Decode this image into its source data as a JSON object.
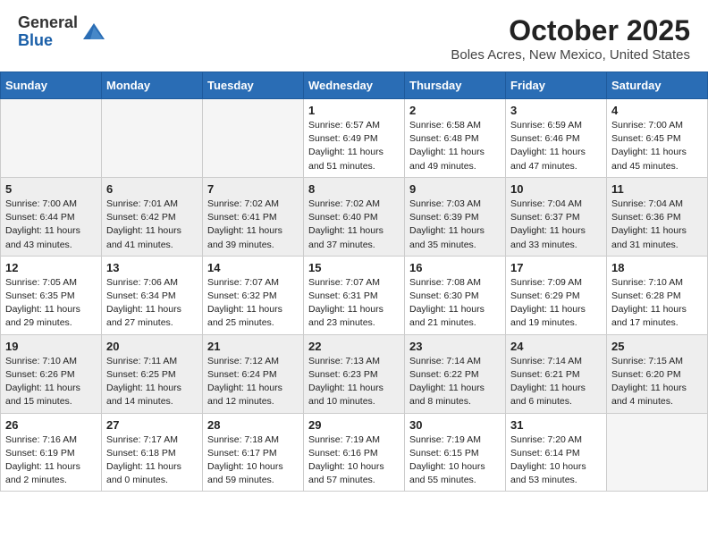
{
  "header": {
    "logo_general": "General",
    "logo_blue": "Blue",
    "month_title": "October 2025",
    "location": "Boles Acres, New Mexico, United States"
  },
  "weekdays": [
    "Sunday",
    "Monday",
    "Tuesday",
    "Wednesday",
    "Thursday",
    "Friday",
    "Saturday"
  ],
  "weeks": [
    {
      "days": [
        {
          "num": "",
          "info": ""
        },
        {
          "num": "",
          "info": ""
        },
        {
          "num": "",
          "info": ""
        },
        {
          "num": "1",
          "info": "Sunrise: 6:57 AM\nSunset: 6:49 PM\nDaylight: 11 hours\nand 51 minutes."
        },
        {
          "num": "2",
          "info": "Sunrise: 6:58 AM\nSunset: 6:48 PM\nDaylight: 11 hours\nand 49 minutes."
        },
        {
          "num": "3",
          "info": "Sunrise: 6:59 AM\nSunset: 6:46 PM\nDaylight: 11 hours\nand 47 minutes."
        },
        {
          "num": "4",
          "info": "Sunrise: 7:00 AM\nSunset: 6:45 PM\nDaylight: 11 hours\nand 45 minutes."
        }
      ]
    },
    {
      "days": [
        {
          "num": "5",
          "info": "Sunrise: 7:00 AM\nSunset: 6:44 PM\nDaylight: 11 hours\nand 43 minutes."
        },
        {
          "num": "6",
          "info": "Sunrise: 7:01 AM\nSunset: 6:42 PM\nDaylight: 11 hours\nand 41 minutes."
        },
        {
          "num": "7",
          "info": "Sunrise: 7:02 AM\nSunset: 6:41 PM\nDaylight: 11 hours\nand 39 minutes."
        },
        {
          "num": "8",
          "info": "Sunrise: 7:02 AM\nSunset: 6:40 PM\nDaylight: 11 hours\nand 37 minutes."
        },
        {
          "num": "9",
          "info": "Sunrise: 7:03 AM\nSunset: 6:39 PM\nDaylight: 11 hours\nand 35 minutes."
        },
        {
          "num": "10",
          "info": "Sunrise: 7:04 AM\nSunset: 6:37 PM\nDaylight: 11 hours\nand 33 minutes."
        },
        {
          "num": "11",
          "info": "Sunrise: 7:04 AM\nSunset: 6:36 PM\nDaylight: 11 hours\nand 31 minutes."
        }
      ]
    },
    {
      "days": [
        {
          "num": "12",
          "info": "Sunrise: 7:05 AM\nSunset: 6:35 PM\nDaylight: 11 hours\nand 29 minutes."
        },
        {
          "num": "13",
          "info": "Sunrise: 7:06 AM\nSunset: 6:34 PM\nDaylight: 11 hours\nand 27 minutes."
        },
        {
          "num": "14",
          "info": "Sunrise: 7:07 AM\nSunset: 6:32 PM\nDaylight: 11 hours\nand 25 minutes."
        },
        {
          "num": "15",
          "info": "Sunrise: 7:07 AM\nSunset: 6:31 PM\nDaylight: 11 hours\nand 23 minutes."
        },
        {
          "num": "16",
          "info": "Sunrise: 7:08 AM\nSunset: 6:30 PM\nDaylight: 11 hours\nand 21 minutes."
        },
        {
          "num": "17",
          "info": "Sunrise: 7:09 AM\nSunset: 6:29 PM\nDaylight: 11 hours\nand 19 minutes."
        },
        {
          "num": "18",
          "info": "Sunrise: 7:10 AM\nSunset: 6:28 PM\nDaylight: 11 hours\nand 17 minutes."
        }
      ]
    },
    {
      "days": [
        {
          "num": "19",
          "info": "Sunrise: 7:10 AM\nSunset: 6:26 PM\nDaylight: 11 hours\nand 15 minutes."
        },
        {
          "num": "20",
          "info": "Sunrise: 7:11 AM\nSunset: 6:25 PM\nDaylight: 11 hours\nand 14 minutes."
        },
        {
          "num": "21",
          "info": "Sunrise: 7:12 AM\nSunset: 6:24 PM\nDaylight: 11 hours\nand 12 minutes."
        },
        {
          "num": "22",
          "info": "Sunrise: 7:13 AM\nSunset: 6:23 PM\nDaylight: 11 hours\nand 10 minutes."
        },
        {
          "num": "23",
          "info": "Sunrise: 7:14 AM\nSunset: 6:22 PM\nDaylight: 11 hours\nand 8 minutes."
        },
        {
          "num": "24",
          "info": "Sunrise: 7:14 AM\nSunset: 6:21 PM\nDaylight: 11 hours\nand 6 minutes."
        },
        {
          "num": "25",
          "info": "Sunrise: 7:15 AM\nSunset: 6:20 PM\nDaylight: 11 hours\nand 4 minutes."
        }
      ]
    },
    {
      "days": [
        {
          "num": "26",
          "info": "Sunrise: 7:16 AM\nSunset: 6:19 PM\nDaylight: 11 hours\nand 2 minutes."
        },
        {
          "num": "27",
          "info": "Sunrise: 7:17 AM\nSunset: 6:18 PM\nDaylight: 11 hours\nand 0 minutes."
        },
        {
          "num": "28",
          "info": "Sunrise: 7:18 AM\nSunset: 6:17 PM\nDaylight: 10 hours\nand 59 minutes."
        },
        {
          "num": "29",
          "info": "Sunrise: 7:19 AM\nSunset: 6:16 PM\nDaylight: 10 hours\nand 57 minutes."
        },
        {
          "num": "30",
          "info": "Sunrise: 7:19 AM\nSunset: 6:15 PM\nDaylight: 10 hours\nand 55 minutes."
        },
        {
          "num": "31",
          "info": "Sunrise: 7:20 AM\nSunset: 6:14 PM\nDaylight: 10 hours\nand 53 minutes."
        },
        {
          "num": "",
          "info": ""
        }
      ]
    }
  ]
}
